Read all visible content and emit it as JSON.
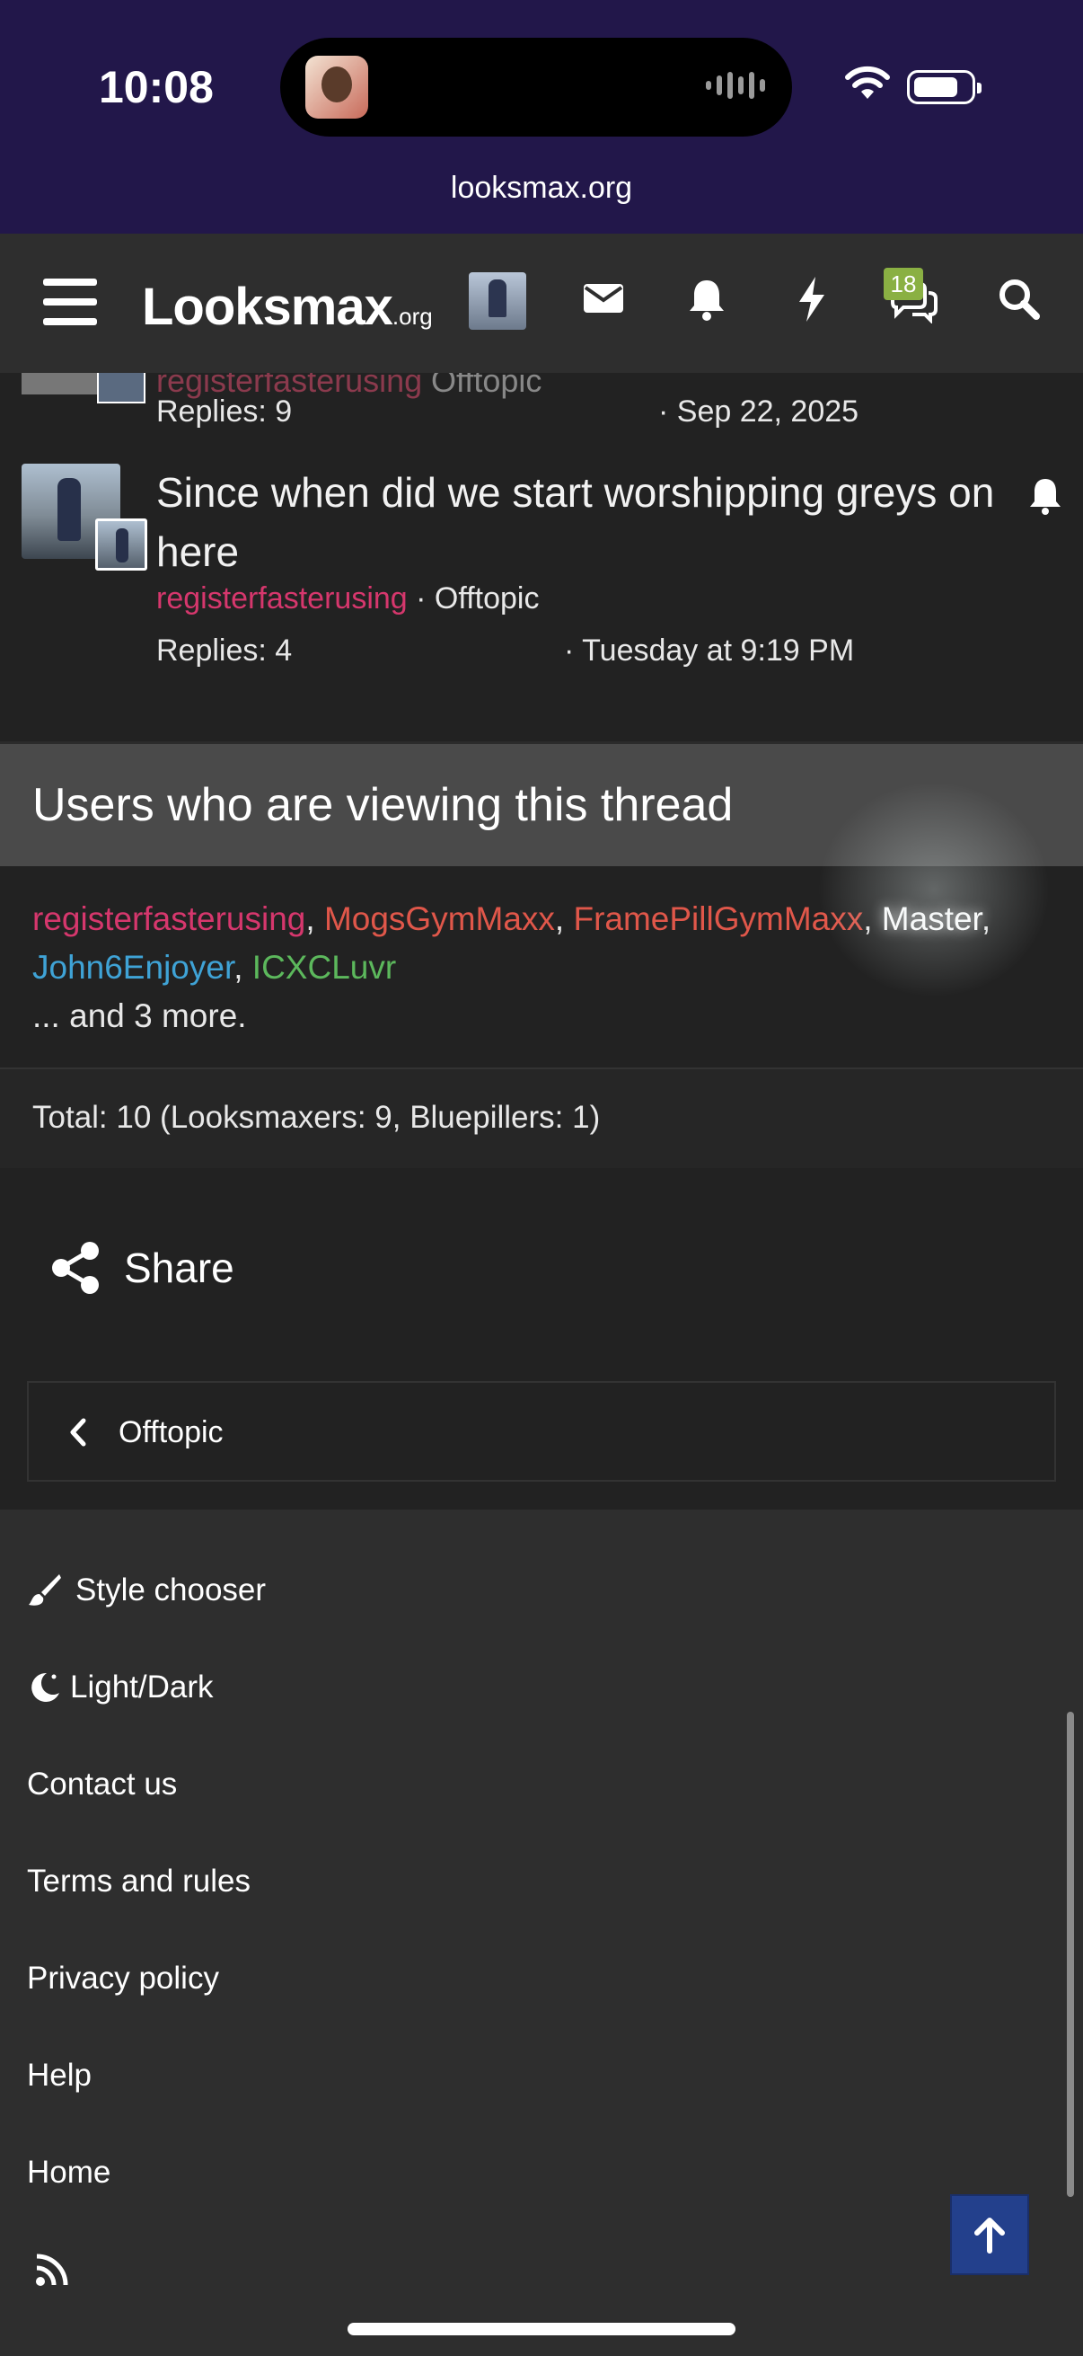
{
  "status": {
    "time": "10:08",
    "url": "looksmax.org"
  },
  "header": {
    "logo_main": "Looksmax",
    "logo_suffix": ".org",
    "messages_badge": "18"
  },
  "threads": [
    {
      "author": "registerfasterusing",
      "category": "Offtopic",
      "replies": "Replies: 9",
      "date": "· Sep 22, 2025"
    },
    {
      "title": "Since when did we start worshipping greys on here",
      "author": "registerfasterusing",
      "category": "· Offtopic",
      "replies": "Replies: 4",
      "date": "· Tuesday at 9:19 PM"
    }
  ],
  "viewers": {
    "title": "Users who are viewing this thread",
    "users": [
      {
        "name": "registerfasterusing",
        "color": "#d6376d"
      },
      {
        "name": "MogsGymMaxx",
        "color": "#e0574a"
      },
      {
        "name": "FramePillGymMaxx",
        "color": "#e0574a"
      },
      {
        "name": "Master",
        "color": "#ffffff"
      },
      {
        "name": "John6Enjoyer",
        "color": "#3fa3d6"
      },
      {
        "name": "ICXCLuvr",
        "color": "#5cb85c"
      }
    ],
    "comma": ",",
    "more": "... and 3 more.",
    "total": "Total: 10 (Looksmaxers: 9, Bluepillers: 1)"
  },
  "share": {
    "label": "Share"
  },
  "back": {
    "label": "Offtopic"
  },
  "footer": {
    "style_chooser": "Style chooser",
    "light_dark": "Light/Dark",
    "contact": "Contact us",
    "terms": "Terms and rules",
    "privacy": "Privacy policy",
    "help": "Help",
    "home": "Home"
  }
}
